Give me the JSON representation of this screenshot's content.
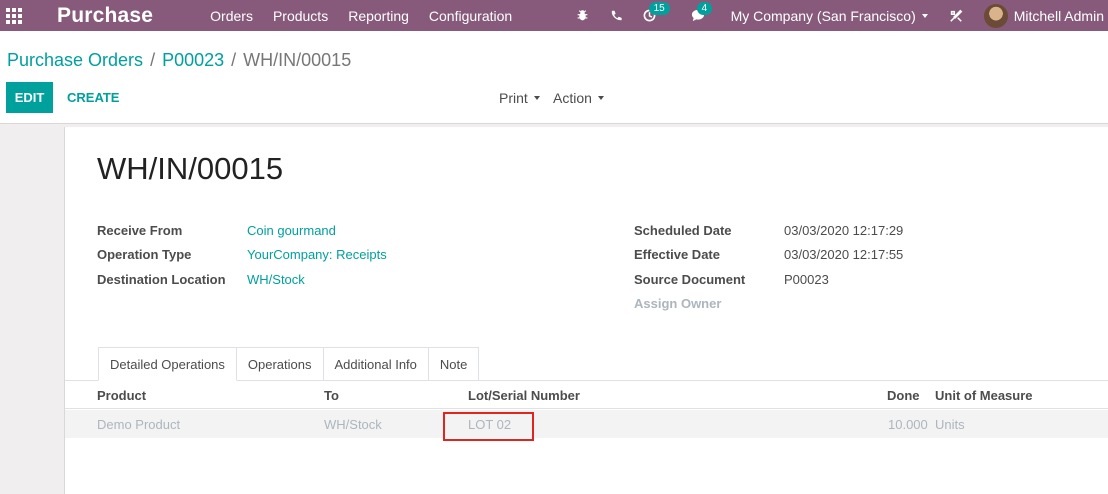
{
  "navbar": {
    "brand": "Purchase",
    "menu": [
      "Orders",
      "Products",
      "Reporting",
      "Configuration"
    ],
    "icons": [
      "bug-icon",
      "phone-icon",
      "clock-icon",
      "chat-icon",
      "tools-icon"
    ],
    "activity_badge": "15",
    "messages_badge": "4",
    "company": "My Company (San Francisco)",
    "user": "Mitchell Admin",
    "color": "#875a7b"
  },
  "breadcrumb": {
    "items": [
      "Purchase Orders",
      "P00023"
    ],
    "current": "WH/IN/00015"
  },
  "buttons": {
    "edit": "EDIT",
    "create": "CREATE",
    "print": "Print",
    "action": "Action",
    "accent": "#00a09d"
  },
  "record": {
    "title": "WH/IN/00015",
    "left_fields": [
      {
        "label": "Receive From",
        "value": "Coin gourmand"
      },
      {
        "label": "Operation Type",
        "value": "YourCompany: Receipts"
      },
      {
        "label": "Destination Location",
        "value": "WH/Stock"
      }
    ],
    "right_fields": [
      {
        "label": "Scheduled Date",
        "value": "03/03/2020 12:17:29"
      },
      {
        "label": "Effective Date",
        "value": "03/03/2020 12:17:55"
      },
      {
        "label": "Source Document",
        "value": "P00023"
      },
      {
        "label": "Assign Owner",
        "value": ""
      }
    ]
  },
  "tabs": [
    "Detailed Operations",
    "Operations",
    "Additional Info",
    "Note"
  ],
  "table": {
    "headers": [
      "Product",
      "To",
      "Lot/Serial Number",
      "Done",
      "Unit of Measure"
    ],
    "rows": [
      {
        "product": "Demo Product",
        "to": "WH/Stock",
        "lot": "LOT 02",
        "done": "10.000",
        "uom": "Units"
      }
    ]
  }
}
